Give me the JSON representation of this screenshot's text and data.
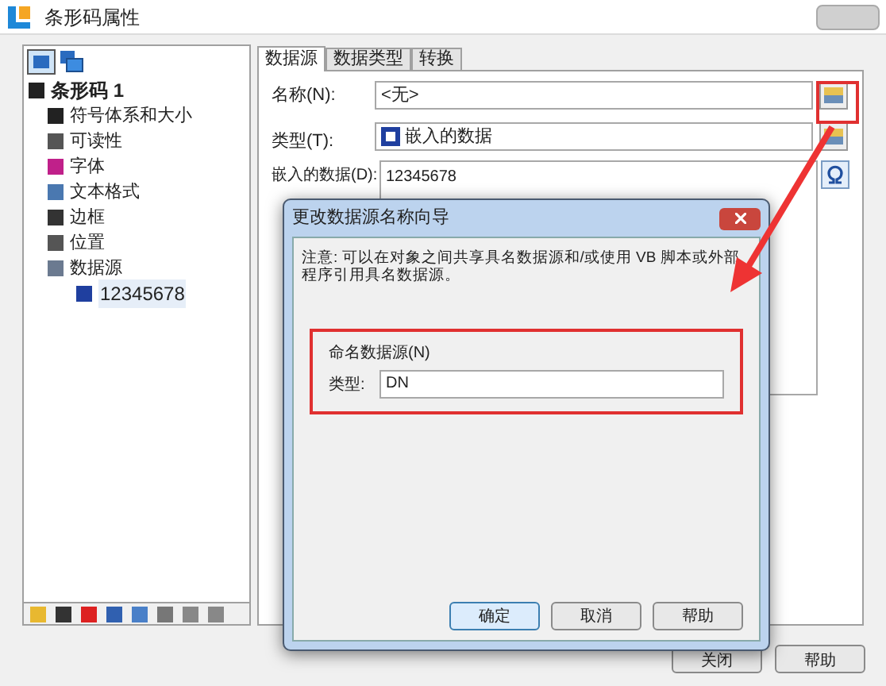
{
  "window": {
    "title": "条形码属性"
  },
  "tree": {
    "items": [
      {
        "label": "条形码 1",
        "selected": false,
        "children": [
          {
            "label": "符号体系和大小",
            "selected": false
          },
          {
            "label": "可读性",
            "selected": false
          },
          {
            "label": "字体",
            "selected": false
          },
          {
            "label": "文本格式",
            "selected": false
          },
          {
            "label": "边框",
            "selected": false
          },
          {
            "label": "位置",
            "selected": false
          },
          {
            "label": "数据源",
            "selected": false,
            "children": [
              {
                "label": "12345678",
                "selected": true
              }
            ]
          }
        ]
      }
    ]
  },
  "tabs": [
    {
      "label": "数据源",
      "selected": true
    },
    {
      "label": "数据类型",
      "selected": false
    },
    {
      "label": "转换",
      "selected": false
    }
  ],
  "form": {
    "name_label": "名称(N):",
    "name_value": "<无>",
    "type_label": "类型(T):",
    "type_value": "嵌入的数据",
    "data_label": "嵌入的数据(D):",
    "data_value": "12345678"
  },
  "dialog": {
    "title": "更改数据源名称向导",
    "note": "注意: 可以在对象之间共享具名数据源和/或使用 VB 脚本或外部程序引用具名数据源。",
    "group_label": "命名数据源(N)",
    "field_label": "类型:",
    "field_value": "DN",
    "buttons": [
      {
        "label": "确定",
        "default": true
      },
      {
        "label": "取消",
        "default": false
      },
      {
        "label": "帮助",
        "default": false
      }
    ]
  },
  "buttons": [
    "关闭",
    "帮助"
  ]
}
